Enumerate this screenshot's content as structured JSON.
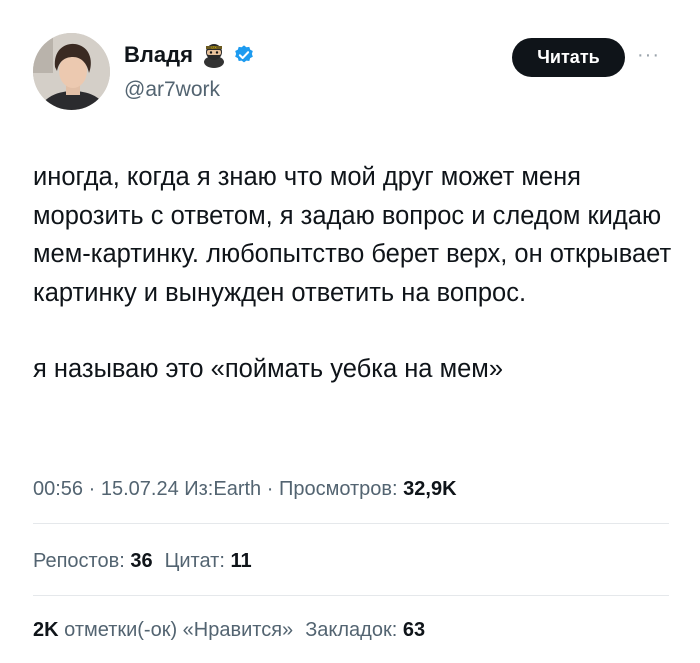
{
  "author": {
    "name": "Владя",
    "handle": "@ar7work",
    "verified": true,
    "badge_icon": "ninja-emoji-icon"
  },
  "follow_label": "Читать",
  "more_label": "···",
  "tweet": {
    "paragraph_1": "иногда, когда я знаю что мой друг может меня морозить с ответом, я задаю вопрос и следом кидаю мем-картинку. любопытство берет верх, он открывает картинку и вынужден ответить на вопрос.",
    "paragraph_2": "я называю это «поймать уебка на мем»"
  },
  "meta": {
    "time": "00:56",
    "dot1": " · ",
    "date": "15.07.24",
    "source": " Из:Earth",
    "dot2": " · ",
    "views_label": "Просмотров: ",
    "views_value": "32,9K"
  },
  "stats": {
    "reposts_label": "Репостов: ",
    "reposts_value": "36",
    "quotes_label": "Цитат: ",
    "quotes_value": "11",
    "likes_value": "2K",
    "likes_label": " отметки(-ок) «Нравится»",
    "bookmarks_label": "Закладок: ",
    "bookmarks_value": "63"
  },
  "colors": {
    "text": "#0f1419",
    "muted": "#536471",
    "verified": "#1d9bf0",
    "button_bg": "#0f1419",
    "divider": "#e5e8eb"
  }
}
